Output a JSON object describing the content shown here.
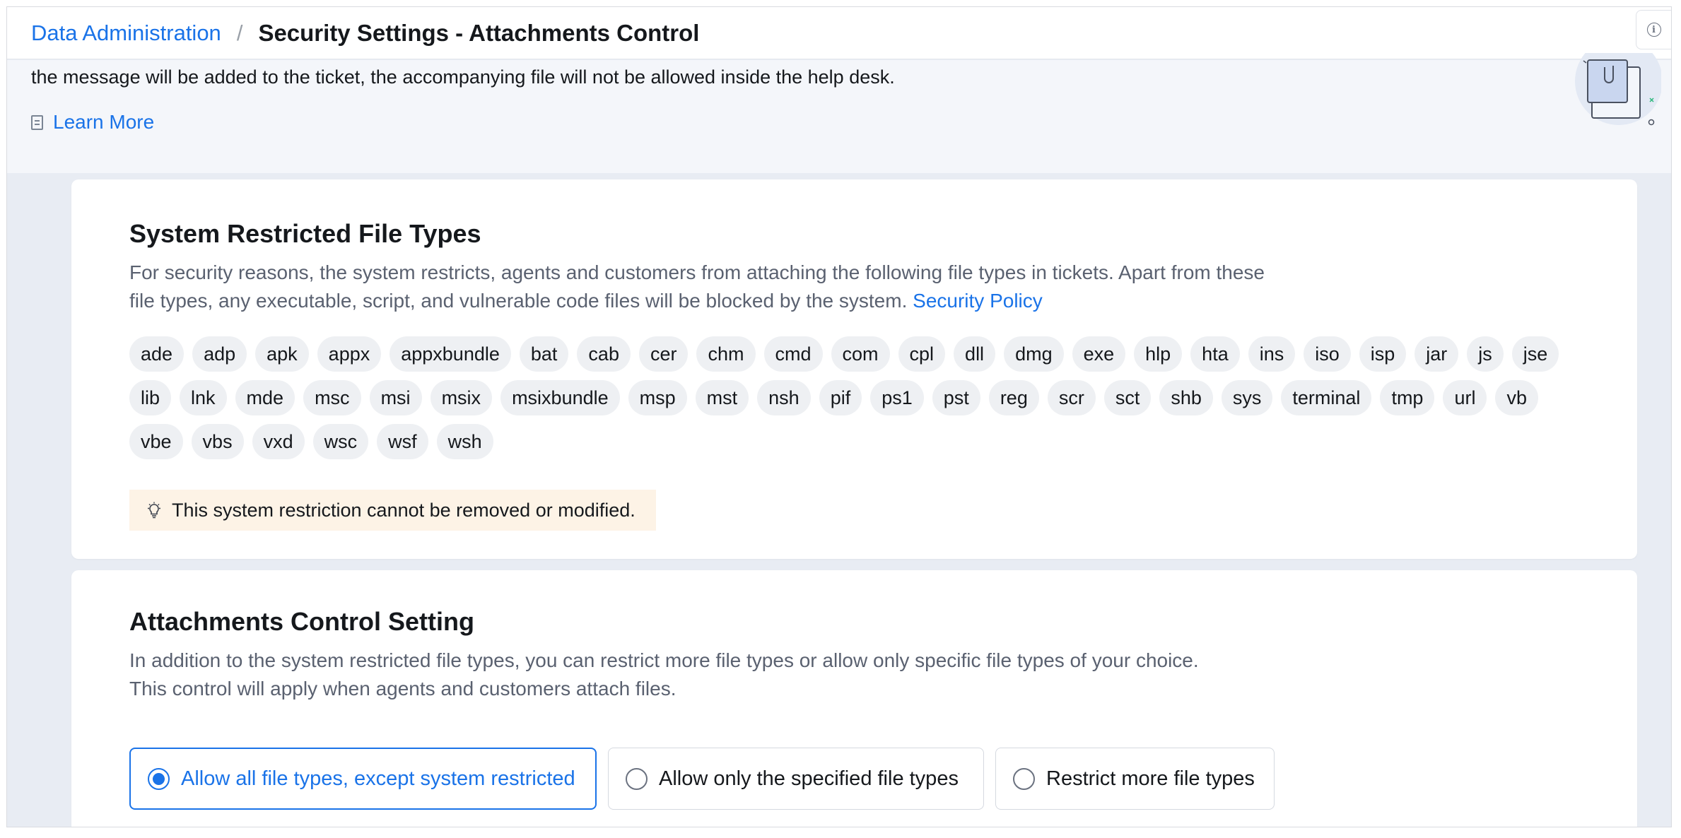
{
  "header": {
    "breadcrumb_parent": "Data Administration",
    "separator": "/",
    "title": "Security Settings - Attachments Control",
    "info_icon": "info-icon"
  },
  "intro": {
    "text": "the message will be added to the ticket, the accompanying file will not be allowed inside the help desk.",
    "learn_more": "Learn More"
  },
  "system_restricted": {
    "title": "System Restricted File Types",
    "description": "For security reasons, the system restricts, agents and customers from attaching the following file types in tickets. Apart from these file types, any executable, script, and vulnerable code files will be blocked by the system.",
    "policy_link": "Security Policy",
    "file_types": [
      "ade",
      "adp",
      "apk",
      "appx",
      "appxbundle",
      "bat",
      "cab",
      "cer",
      "chm",
      "cmd",
      "com",
      "cpl",
      "dll",
      "dmg",
      "exe",
      "hlp",
      "hta",
      "ins",
      "iso",
      "isp",
      "jar",
      "js",
      "jse",
      "lib",
      "lnk",
      "mde",
      "msc",
      "msi",
      "msix",
      "msixbundle",
      "msp",
      "mst",
      "nsh",
      "pif",
      "ps1",
      "pst",
      "reg",
      "scr",
      "sct",
      "shb",
      "sys",
      "terminal",
      "tmp",
      "url",
      "vb",
      "vbe",
      "vbs",
      "vxd",
      "wsc",
      "wsf",
      "wsh"
    ],
    "note": "This system restriction cannot be removed or modified."
  },
  "attachments_control": {
    "title": "Attachments Control Setting",
    "description_line1": "In addition to the system restricted file types, you can restrict more file types or allow only specific file types of your choice.",
    "description_line2": "This control will apply when agents and customers attach files.",
    "options": [
      {
        "label": "Allow all file types, except system restricted",
        "selected": true
      },
      {
        "label": "Allow only the specified file types",
        "selected": false
      },
      {
        "label": "Restrict more file types",
        "selected": false
      }
    ]
  },
  "colors": {
    "accent": "#1a73e8",
    "note_bg": "#fdf3e6",
    "chip_bg": "#eef0f3",
    "page_bg": "#e8ecf3"
  }
}
